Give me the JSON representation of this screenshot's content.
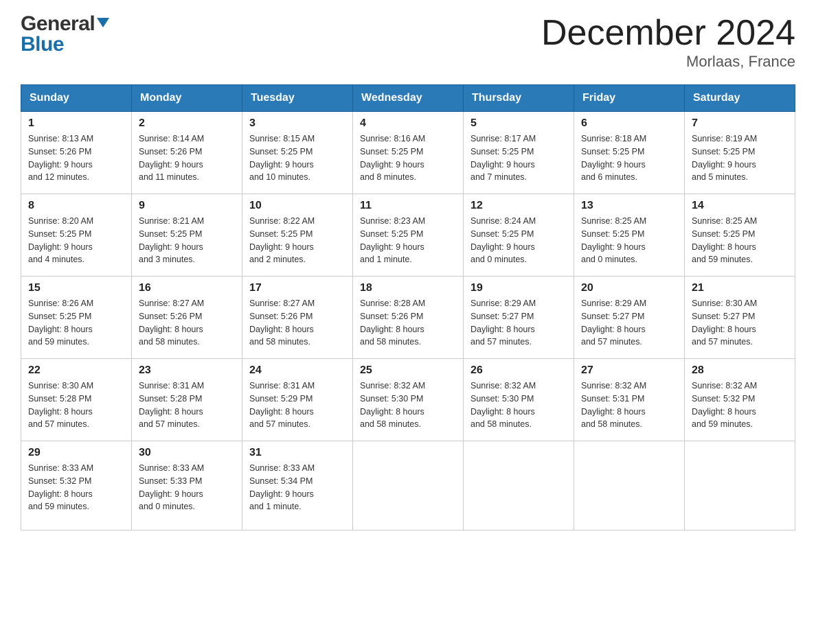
{
  "logo": {
    "general": "General",
    "blue": "Blue",
    "arrowColor": "#1a6fa8"
  },
  "title": {
    "month_year": "December 2024",
    "location": "Morlaas, France"
  },
  "weekdays": [
    "Sunday",
    "Monday",
    "Tuesday",
    "Wednesday",
    "Thursday",
    "Friday",
    "Saturday"
  ],
  "weeks": [
    [
      {
        "day": "1",
        "sunrise": "8:13 AM",
        "sunset": "5:26 PM",
        "daylight": "9 hours and 12 minutes."
      },
      {
        "day": "2",
        "sunrise": "8:14 AM",
        "sunset": "5:26 PM",
        "daylight": "9 hours and 11 minutes."
      },
      {
        "day": "3",
        "sunrise": "8:15 AM",
        "sunset": "5:25 PM",
        "daylight": "9 hours and 10 minutes."
      },
      {
        "day": "4",
        "sunrise": "8:16 AM",
        "sunset": "5:25 PM",
        "daylight": "9 hours and 8 minutes."
      },
      {
        "day": "5",
        "sunrise": "8:17 AM",
        "sunset": "5:25 PM",
        "daylight": "9 hours and 7 minutes."
      },
      {
        "day": "6",
        "sunrise": "8:18 AM",
        "sunset": "5:25 PM",
        "daylight": "9 hours and 6 minutes."
      },
      {
        "day": "7",
        "sunrise": "8:19 AM",
        "sunset": "5:25 PM",
        "daylight": "9 hours and 5 minutes."
      }
    ],
    [
      {
        "day": "8",
        "sunrise": "8:20 AM",
        "sunset": "5:25 PM",
        "daylight": "9 hours and 4 minutes."
      },
      {
        "day": "9",
        "sunrise": "8:21 AM",
        "sunset": "5:25 PM",
        "daylight": "9 hours and 3 minutes."
      },
      {
        "day": "10",
        "sunrise": "8:22 AM",
        "sunset": "5:25 PM",
        "daylight": "9 hours and 2 minutes."
      },
      {
        "day": "11",
        "sunrise": "8:23 AM",
        "sunset": "5:25 PM",
        "daylight": "9 hours and 1 minute."
      },
      {
        "day": "12",
        "sunrise": "8:24 AM",
        "sunset": "5:25 PM",
        "daylight": "9 hours and 0 minutes."
      },
      {
        "day": "13",
        "sunrise": "8:25 AM",
        "sunset": "5:25 PM",
        "daylight": "9 hours and 0 minutes."
      },
      {
        "day": "14",
        "sunrise": "8:25 AM",
        "sunset": "5:25 PM",
        "daylight": "8 hours and 59 minutes."
      }
    ],
    [
      {
        "day": "15",
        "sunrise": "8:26 AM",
        "sunset": "5:25 PM",
        "daylight": "8 hours and 59 minutes."
      },
      {
        "day": "16",
        "sunrise": "8:27 AM",
        "sunset": "5:26 PM",
        "daylight": "8 hours and 58 minutes."
      },
      {
        "day": "17",
        "sunrise": "8:27 AM",
        "sunset": "5:26 PM",
        "daylight": "8 hours and 58 minutes."
      },
      {
        "day": "18",
        "sunrise": "8:28 AM",
        "sunset": "5:26 PM",
        "daylight": "8 hours and 58 minutes."
      },
      {
        "day": "19",
        "sunrise": "8:29 AM",
        "sunset": "5:27 PM",
        "daylight": "8 hours and 57 minutes."
      },
      {
        "day": "20",
        "sunrise": "8:29 AM",
        "sunset": "5:27 PM",
        "daylight": "8 hours and 57 minutes."
      },
      {
        "day": "21",
        "sunrise": "8:30 AM",
        "sunset": "5:27 PM",
        "daylight": "8 hours and 57 minutes."
      }
    ],
    [
      {
        "day": "22",
        "sunrise": "8:30 AM",
        "sunset": "5:28 PM",
        "daylight": "8 hours and 57 minutes."
      },
      {
        "day": "23",
        "sunrise": "8:31 AM",
        "sunset": "5:28 PM",
        "daylight": "8 hours and 57 minutes."
      },
      {
        "day": "24",
        "sunrise": "8:31 AM",
        "sunset": "5:29 PM",
        "daylight": "8 hours and 57 minutes."
      },
      {
        "day": "25",
        "sunrise": "8:32 AM",
        "sunset": "5:30 PM",
        "daylight": "8 hours and 58 minutes."
      },
      {
        "day": "26",
        "sunrise": "8:32 AM",
        "sunset": "5:30 PM",
        "daylight": "8 hours and 58 minutes."
      },
      {
        "day": "27",
        "sunrise": "8:32 AM",
        "sunset": "5:31 PM",
        "daylight": "8 hours and 58 minutes."
      },
      {
        "day": "28",
        "sunrise": "8:32 AM",
        "sunset": "5:32 PM",
        "daylight": "8 hours and 59 minutes."
      }
    ],
    [
      {
        "day": "29",
        "sunrise": "8:33 AM",
        "sunset": "5:32 PM",
        "daylight": "8 hours and 59 minutes."
      },
      {
        "day": "30",
        "sunrise": "8:33 AM",
        "sunset": "5:33 PM",
        "daylight": "9 hours and 0 minutes."
      },
      {
        "day": "31",
        "sunrise": "8:33 AM",
        "sunset": "5:34 PM",
        "daylight": "9 hours and 1 minute."
      },
      null,
      null,
      null,
      null
    ]
  ],
  "labels": {
    "sunrise": "Sunrise:",
    "sunset": "Sunset:",
    "daylight": "Daylight:"
  }
}
